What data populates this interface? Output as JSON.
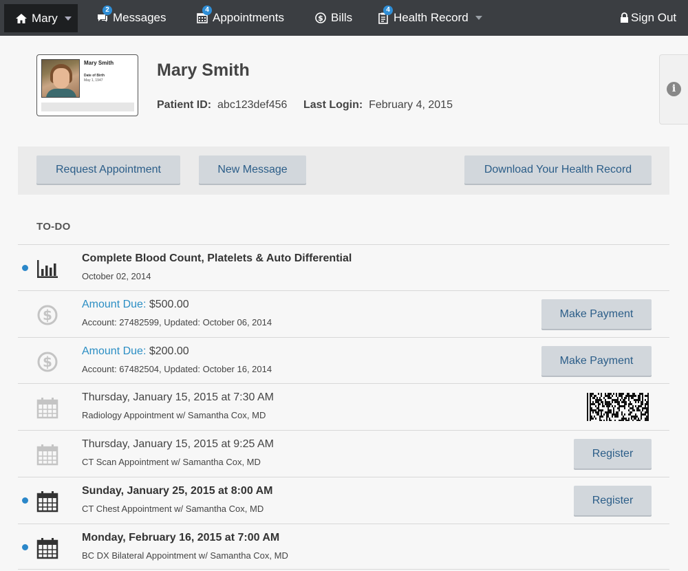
{
  "nav": {
    "user_label": "Mary",
    "messages_label": "Messages",
    "messages_badge": "2",
    "appointments_label": "Appointments",
    "appointments_badge": "4",
    "bills_label": "Bills",
    "health_record_label": "Health Record",
    "health_record_badge": "4",
    "sign_out_label": "Sign Out"
  },
  "profile": {
    "card_name": "Mary Smith",
    "card_dob_label": "Date of Birth",
    "card_dob": "May 1, 1947",
    "name": "Mary Smith",
    "patient_id_label": "Patient ID:",
    "patient_id": "abc123def456",
    "last_login_label": "Last Login:",
    "last_login": "February 4, 2015"
  },
  "actions": {
    "request_appointment": "Request Appointment",
    "new_message": "New Message",
    "download_record": "Download Your Health Record"
  },
  "todo": {
    "title": "TO-DO",
    "items": [
      {
        "icon": "bar-chart-icon",
        "unread": true,
        "title": "Complete Blood Count, Platelets & Auto Differential",
        "subtitle": "October 02, 2014"
      },
      {
        "icon": "dollar-icon",
        "unread": false,
        "amount_label": "Amount Due:",
        "amount": "$500.00",
        "subtitle": "Account: 27482599, Updated: October 06, 2014",
        "action": "Make Payment"
      },
      {
        "icon": "dollar-icon",
        "unread": false,
        "amount_label": "Amount Due:",
        "amount": "$200.00",
        "subtitle": "Account: 67482504, Updated: October 16, 2014",
        "action": "Make Payment"
      },
      {
        "icon": "calendar-icon",
        "unread": false,
        "title": "Thursday, January 15, 2015 at 7:30 AM",
        "subtitle": "Radiology Appointment w/ Samantha Cox, MD",
        "action": "barcode"
      },
      {
        "icon": "calendar-icon",
        "unread": false,
        "title": "Thursday, January 15, 2015 at 9:25 AM",
        "subtitle": "CT Scan Appointment w/ Samantha Cox, MD",
        "action": "Register"
      },
      {
        "icon": "calendar-icon",
        "unread": true,
        "title": "Sunday, January 25, 2015 at 8:00 AM",
        "subtitle": "CT Chest Appointment w/ Samantha Cox, MD",
        "action": "Register"
      },
      {
        "icon": "calendar-icon",
        "unread": true,
        "title": "Monday, February 16, 2015 at 7:00 AM",
        "subtitle": "BC DX Bilateral Appointment w/ Samantha Cox, MD"
      }
    ]
  },
  "colors": {
    "nav_bg": "#3b3e42",
    "accent": "#2b87c9",
    "button_bg": "#d2d7dc",
    "button_text": "#2b5d88"
  }
}
